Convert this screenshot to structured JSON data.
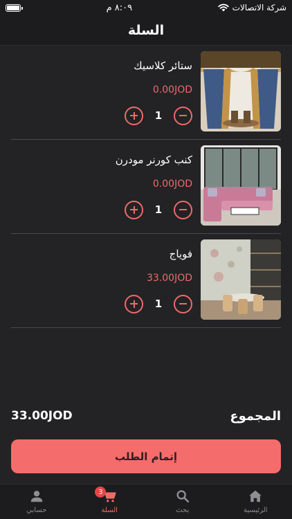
{
  "status_bar": {
    "carrier": "شركة الاتصالات",
    "time": "٨:٠٩ م"
  },
  "header": {
    "title": "السلة"
  },
  "cart": {
    "items": [
      {
        "name": "ستائر كلاسيك",
        "price": "0.00JOD",
        "quantity": "1",
        "image": "classic-curtains-photo"
      },
      {
        "name": "كنب كورنر مودرن",
        "price": "0.00JOD",
        "quantity": "1",
        "image": "modern-corner-sofa-photo"
      },
      {
        "name": "فوياج",
        "price": "33.00JOD",
        "quantity": "1",
        "image": "dining-room-wallpaper-photo"
      }
    ]
  },
  "summary": {
    "total_label": "المجموع",
    "total_value": "33.00JOD"
  },
  "checkout": {
    "label": "إتمام الطلب"
  },
  "tab_bar": {
    "tabs": [
      {
        "label": "حسابي",
        "icon": "person-icon"
      },
      {
        "label": "السلة",
        "icon": "cart-icon",
        "badge": "3",
        "active": true
      },
      {
        "label": "بحث",
        "icon": "search-icon"
      },
      {
        "label": "الرئيسية",
        "icon": "home-icon"
      }
    ]
  },
  "colors": {
    "background": "#232325",
    "accent": "#f06a6a",
    "checkout_button": "#f56c6c",
    "badge": "#e64545"
  }
}
